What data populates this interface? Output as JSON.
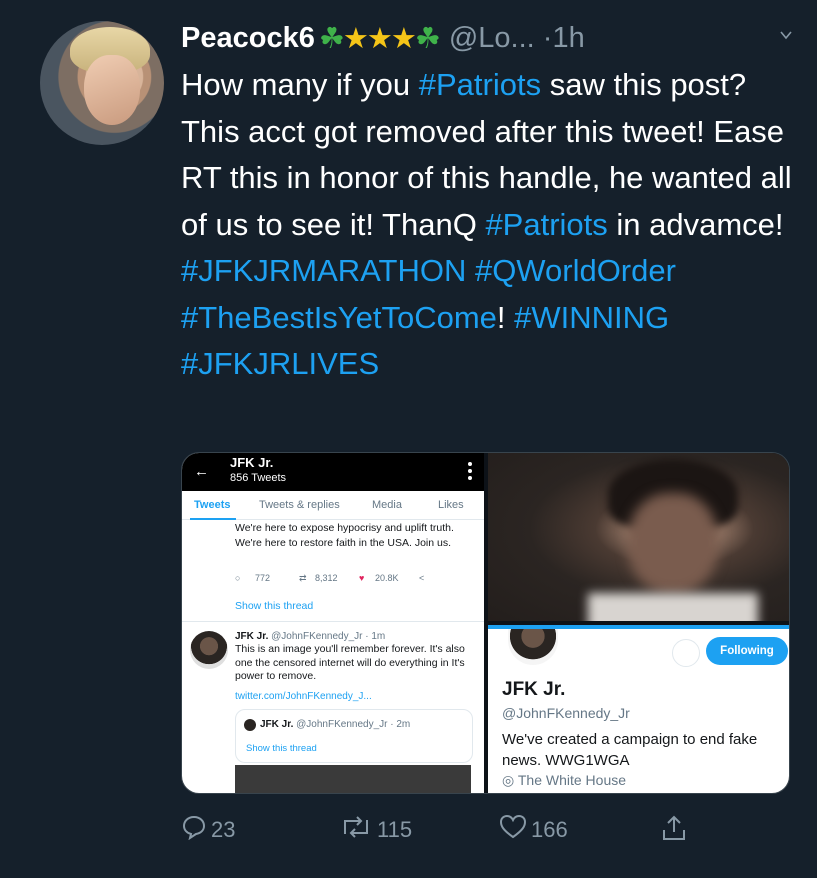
{
  "tweet": {
    "author_name": "Peacock6",
    "author_emojis": [
      "☘",
      "★",
      "★",
      "★",
      "☘"
    ],
    "handle": "@Lo...",
    "separator": "·",
    "time": "1h",
    "text_parts": [
      {
        "t": "How many if you ",
        "tag": false
      },
      {
        "t": "#Patriots",
        "tag": true
      },
      {
        "t": " saw this post? This acct got removed after this tweet! Ease RT this in honor of this handle, he wanted all of us to see it!  ThanQ ",
        "tag": false
      },
      {
        "t": "#Patriots",
        "tag": true
      },
      {
        "t": " in advamce! ",
        "tag": false
      },
      {
        "t": "#JFKJRMARATHON",
        "tag": true
      },
      {
        "t": " ",
        "tag": false
      },
      {
        "t": "#QWorldOrder",
        "tag": true
      },
      {
        "t": " ",
        "tag": false
      },
      {
        "t": "#TheBestIsYetToCome",
        "tag": true
      },
      {
        "t": "! ",
        "tag": false
      },
      {
        "t": "#WINNING",
        "tag": true
      },
      {
        "t": " ",
        "tag": false
      },
      {
        "t": "#JFKJRLIVES",
        "tag": true
      }
    ]
  },
  "media_left": {
    "back_arrow": "←",
    "title": "JFK Jr.",
    "tweets_count": "856 Tweets",
    "tabs": [
      "Tweets",
      "Tweets & replies",
      "Media",
      "Likes"
    ],
    "tweet1_text": "We're here to expose hypocrisy and uplift truth. We're here to restore faith in the USA. Join us.",
    "reply_count": "772",
    "retweet_count": "8,312",
    "like_count": "20.8K",
    "show_thread": "Show this thread",
    "tweet2_name": "JFK Jr.",
    "tweet2_meta": "@JohnFKennedy_Jr · 1m",
    "tweet2_text": "This is an image you'll remember forever. It's also one the censored internet will do everything in It's power to remove.",
    "tweet2_link": "twitter.com/JohnFKennedy_J...",
    "quote_name": "JFK Jr.",
    "quote_meta": "@JohnFKennedy_Jr · 2m",
    "quote_show_thread": "Show this thread"
  },
  "media_right": {
    "following_label": "Following",
    "name": "JFK Jr.",
    "handle": "@JohnFKennedy_Jr",
    "bio": "We've created a campaign to end fake news. WWG1WGA",
    "location": "The White House"
  },
  "footer": {
    "replies": "23",
    "retweets": "115",
    "likes": "166"
  },
  "colors": {
    "background": "#15202b",
    "hashtag": "#1da1f2",
    "muted": "#8899a6"
  }
}
